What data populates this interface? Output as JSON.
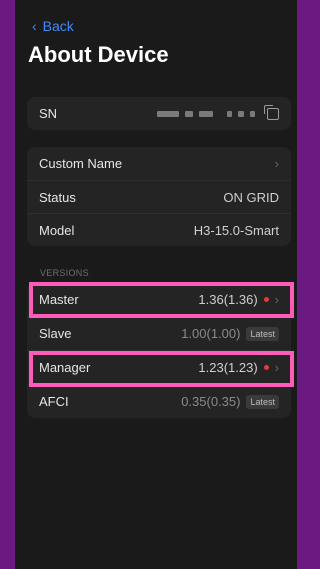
{
  "nav": {
    "back_label": "Back"
  },
  "page": {
    "title": "About Device"
  },
  "sn": {
    "label": "SN"
  },
  "info": [
    {
      "label": "Custom Name",
      "value": ""
    },
    {
      "label": "Status",
      "value": "ON GRID"
    },
    {
      "label": "Model",
      "value": "H3-15.0-Smart"
    }
  ],
  "versions": {
    "section_label": "VERSIONS",
    "items": [
      {
        "label": "Master",
        "value": "1.36(1.36)",
        "update_available": true,
        "badge": ""
      },
      {
        "label": "Slave",
        "value": "1.00(1.00)",
        "update_available": false,
        "badge": "Latest"
      },
      {
        "label": "Manager",
        "value": "1.23(1.23)",
        "update_available": true,
        "badge": ""
      },
      {
        "label": "AFCI",
        "value": "0.35(0.35)",
        "update_available": false,
        "badge": "Latest"
      }
    ]
  },
  "colors": {
    "accent": "#3d8bff",
    "highlight": "#ff5cb8",
    "update_dot": "#e23b3b",
    "frame": "#6a1a80"
  }
}
